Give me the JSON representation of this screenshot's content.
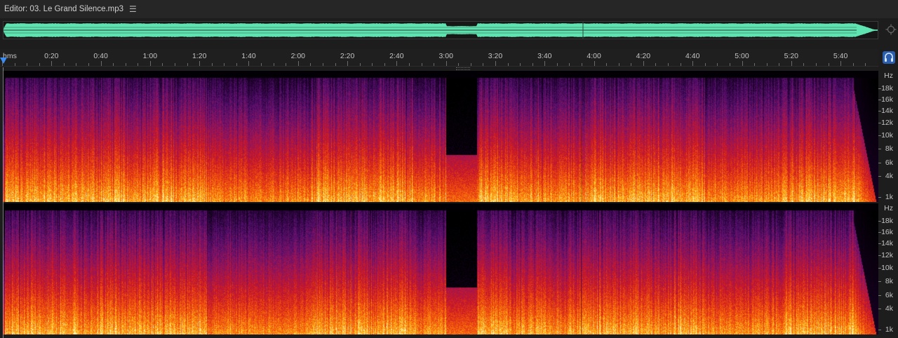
{
  "window": {
    "title": "Editor: 03. Le Grand Silence.mp3",
    "menu_icon": "hamburger-menu-icon"
  },
  "overview": {
    "waveform_color": "#5fe3b0",
    "zoom_icon": "zoom-navigator-icon"
  },
  "timeline": {
    "unit_label": "hms",
    "labels": [
      "0:20",
      "0:40",
      "1:00",
      "1:20",
      "1:40",
      "2:00",
      "2:20",
      "2:40",
      "3:00",
      "3:20",
      "3:40",
      "4:00",
      "4:20",
      "4:40",
      "5:00",
      "5:20",
      "5:40"
    ],
    "playhead_color": "#3d8cf0",
    "monitor_icon": "headphones-icon"
  },
  "spectral": {
    "channels": [
      {
        "unit_label": "Hz",
        "freq_labels": [
          "18k",
          "16k",
          "14k",
          "12k",
          "10k",
          "8k",
          "6k",
          "4k",
          "1k"
        ]
      },
      {
        "unit_label": "Hz",
        "freq_labels": [
          "18k",
          "16k",
          "14k",
          "12k",
          "10k",
          "8k",
          "6k",
          "4k",
          "1k"
        ]
      }
    ]
  }
}
